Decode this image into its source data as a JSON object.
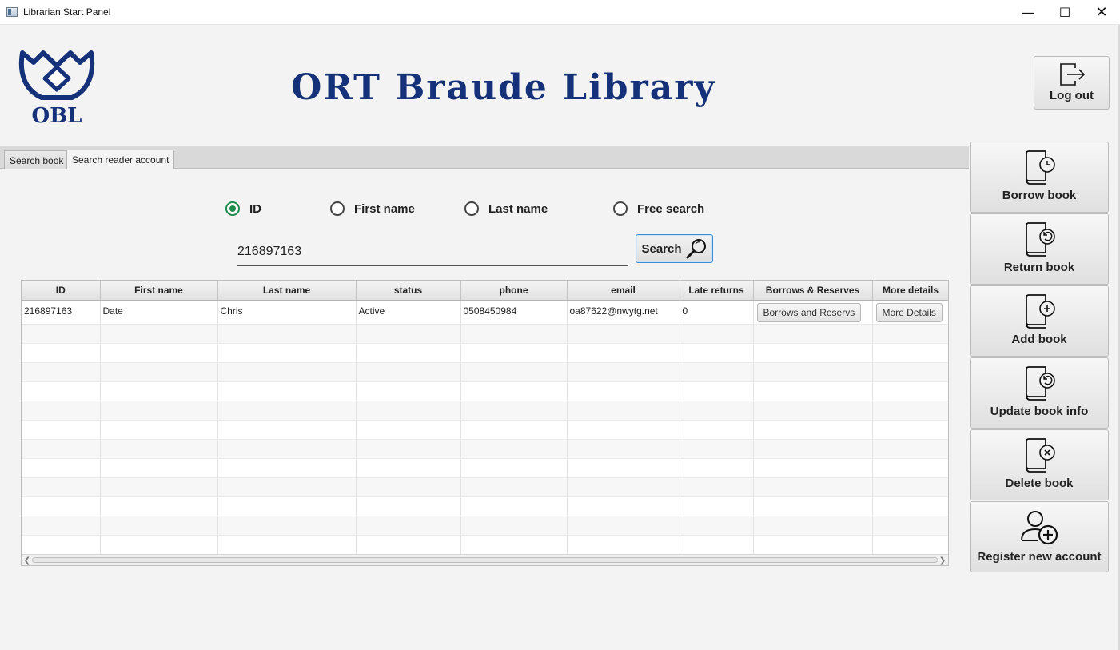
{
  "window": {
    "title": "Librarian Start Panel",
    "minimize": "—",
    "maximize": "☐",
    "close": "✕"
  },
  "header": {
    "logo_text": "OBL",
    "brand_title": "ORT Braude Library",
    "logout_label": "Log out",
    "brand_color": "#14317a"
  },
  "tabs": [
    {
      "label": "Search book",
      "active": false
    },
    {
      "label": "Search reader account",
      "active": true
    }
  ],
  "search": {
    "options": [
      {
        "label": "ID",
        "checked": true
      },
      {
        "label": "First name",
        "checked": false
      },
      {
        "label": "Last name",
        "checked": false
      },
      {
        "label": "Free search",
        "checked": false
      }
    ],
    "value": "216897163",
    "button_label": "Search"
  },
  "table": {
    "columns": [
      "ID",
      "First name",
      "Last name",
      "status",
      "phone",
      "email",
      "Late returns",
      "Borrows & Reserves",
      "More details"
    ],
    "rows": [
      {
        "id": "216897163",
        "first_name": "Date",
        "last_name": "Chris",
        "status": "Active",
        "phone": "0508450984",
        "email": "oa87622@nwytg.net",
        "late_returns": "0",
        "borrows_button": "Borrows and Reservs",
        "details_button": "More Details"
      }
    ]
  },
  "side_actions": [
    {
      "label": "Borrow book",
      "icon": "book-clock-icon"
    },
    {
      "label": "Return book",
      "icon": "book-return-icon"
    },
    {
      "label": "Add book",
      "icon": "book-add-icon"
    },
    {
      "label": "Update book info",
      "icon": "book-update-icon"
    },
    {
      "label": "Delete book",
      "icon": "book-delete-icon"
    },
    {
      "label": "Register new account",
      "icon": "user-add-icon"
    }
  ],
  "colors": {
    "accent_radio": "#1e8a4c",
    "focus_border": "#3c8bd6"
  }
}
